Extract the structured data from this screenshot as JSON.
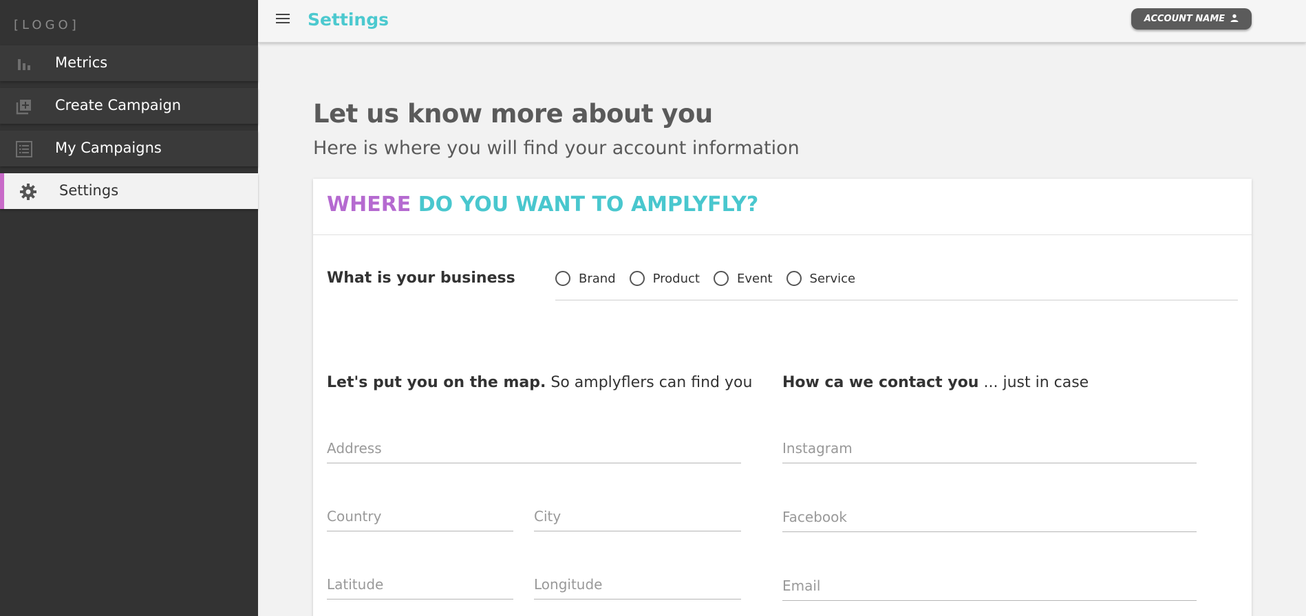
{
  "sidebar": {
    "logo": "[LOGO]",
    "items": [
      {
        "label": "Metrics",
        "icon": "bar-chart-icon"
      },
      {
        "label": "Create Campaign",
        "icon": "add-library-icon"
      },
      {
        "label": "My Campaigns",
        "icon": "list-icon"
      },
      {
        "label": "Settings",
        "icon": "gear-icon"
      }
    ]
  },
  "header": {
    "title": "Settings",
    "account_label": "ACCOUNT NAME"
  },
  "main": {
    "title": "Let us know more about you",
    "subtitle": "Here is where you will find your account information",
    "card": {
      "heading_part1": "WHERE",
      "heading_part2": "DO YOU WANT TO AMPLYFLY?",
      "business_question": "What is your business",
      "business_options": [
        "Brand",
        "Product",
        "Event",
        "Service"
      ],
      "location_head_bold": "Let's put you on the map.",
      "location_head_rest": " So amplyflers can find you",
      "contact_head_bold": "How ca we contact you",
      "contact_head_rest": " ... just in case",
      "fields": {
        "address": "Address",
        "country": "Country",
        "city": "City",
        "latitude": "Latitude",
        "longitude": "Longitude",
        "instagram": "Instagram",
        "facebook": "Facebook",
        "email": "Email"
      }
    }
  },
  "colors": {
    "accent_teal": "#4cc9cf",
    "accent_purple": "#b56ad0",
    "sidebar_bg": "#333333"
  }
}
